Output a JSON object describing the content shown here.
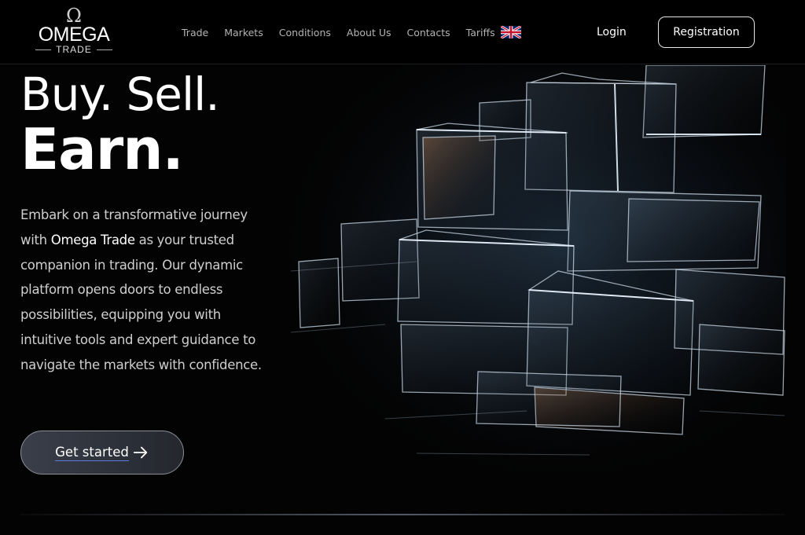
{
  "header": {
    "logo": {
      "symbol": "Ω",
      "name": "OMEGA",
      "sub": "TRADE"
    },
    "nav": [
      "Trade",
      "Markets",
      "Conditions",
      "About Us",
      "Contacts",
      "Tariffs"
    ],
    "language_flag": "uk-flag-icon",
    "login_label": "Login",
    "register_label": "Registration"
  },
  "hero": {
    "line1": "Buy. Sell.",
    "line2": "Earn.",
    "description_before": "Embark on a transformative journey with ",
    "description_brand": "Omega Trade",
    "description_after": " as your trusted companion in trading. Our dynamic platform opens doors to endless possibilities, equipping you with intuitive tools and expert guidance to navigate the markets with confidence.",
    "cta_label": "Get started",
    "cta_icon": "arrow-right-icon"
  },
  "colors": {
    "background": "#030303",
    "header_bg": "#000000",
    "text": "#ffffff",
    "muted_text": "#cfcfcf",
    "nav_text": "#b3b3b3",
    "cta_bg": "#2e323b",
    "cta_underline": "#5b7be0"
  }
}
